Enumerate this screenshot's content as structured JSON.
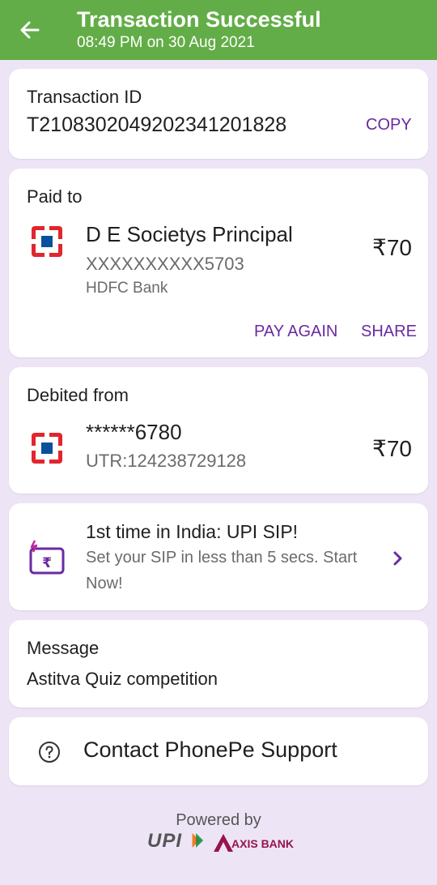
{
  "header": {
    "title": "Transaction Successful",
    "subtitle": "08:49 PM on 30 Aug 2021",
    "back_icon": "arrow-left-icon",
    "color": "#62ad47"
  },
  "transaction": {
    "label": "Transaction ID",
    "id": "T2108302049202341201828",
    "copy_label": "COPY"
  },
  "paid_to": {
    "label": "Paid to",
    "name": "D E Societys Principal",
    "account": "XXXXXXXXXX5703",
    "bank": "HDFC Bank",
    "amount": "₹70",
    "pay_again_label": "PAY AGAIN",
    "share_label": "SHARE"
  },
  "debited_from": {
    "label": "Debited from",
    "account": "******6780",
    "utr": "UTR:124238729128",
    "amount": "₹70"
  },
  "promo": {
    "title": "1st time in India: UPI SIP!",
    "line1": "Set your SIP in less than 5 secs. Start",
    "line2": "Now!",
    "icon": "rupee-card-icon"
  },
  "message": {
    "label": "Message",
    "text": "Astitva Quiz competition"
  },
  "support": {
    "label": "Contact PhonePe Support",
    "icon": "question-circle-icon"
  },
  "footer": {
    "powered_by": "Powered by",
    "upi_logo_text": "UPI",
    "axis_logo_text": "AXIS BANK"
  },
  "colors": {
    "accent_purple": "#6a2aa0",
    "background": "#ede5f6",
    "hdfc_red": "#e0262e",
    "hdfc_blue": "#0a4f9c"
  }
}
